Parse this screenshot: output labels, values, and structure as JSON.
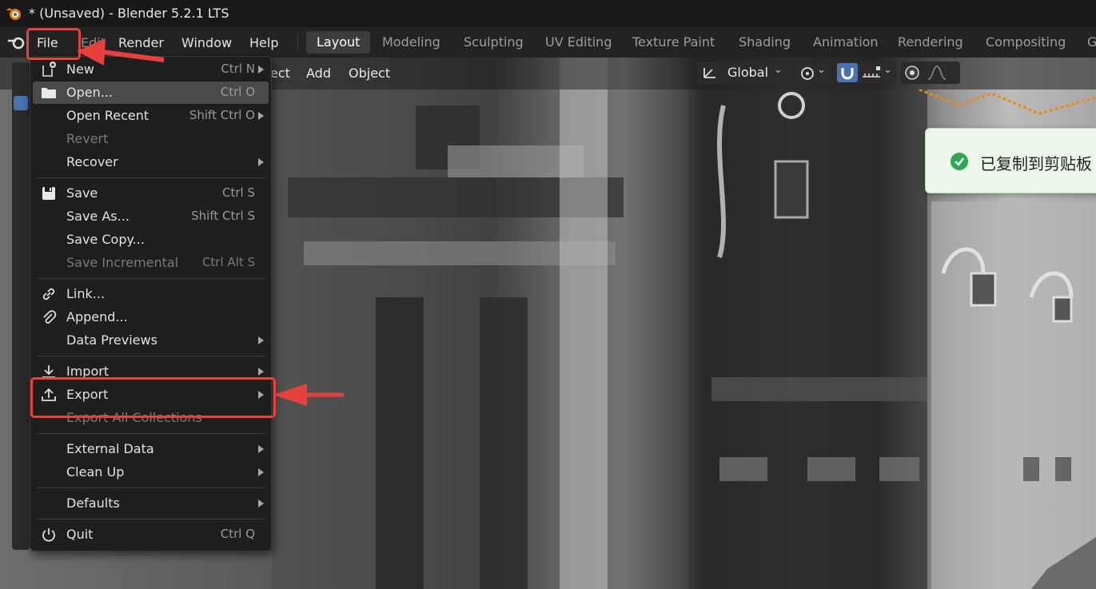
{
  "window": {
    "title": "* (Unsaved) - Blender 5.2.1 LTS"
  },
  "menubar": {
    "items": [
      "File",
      "Edit",
      "Render",
      "Window",
      "Help"
    ]
  },
  "workspaces": {
    "tabs": [
      "Layout",
      "Modeling",
      "Sculpting",
      "UV Editing",
      "Texture Paint",
      "Shading",
      "Animation",
      "Rendering",
      "Compositing",
      "G"
    ],
    "active": "Layout"
  },
  "viewport_header": {
    "select_partial": "ect",
    "add": "Add",
    "object": "Object",
    "transform_orientation": "Global",
    "left_edge_char": "#"
  },
  "file_menu": {
    "items": [
      {
        "label": "New",
        "shortcut": "Ctrl N",
        "submenu": true,
        "icon": "new-file-icon"
      },
      {
        "label": "Open...",
        "shortcut": "Ctrl O",
        "highlight": true,
        "icon": "folder-icon"
      },
      {
        "label": "Open Recent",
        "shortcut": "Shift Ctrl O",
        "submenu": true
      },
      {
        "label": "Revert",
        "disabled": true
      },
      {
        "label": "Recover",
        "submenu": true
      },
      {
        "label": "Save",
        "shortcut": "Ctrl S",
        "icon": "save-icon"
      },
      {
        "label": "Save As...",
        "shortcut": "Shift Ctrl S"
      },
      {
        "label": "Save Copy..."
      },
      {
        "label": "Save Incremental",
        "shortcut": "Ctrl Alt S",
        "disabled": true
      },
      {
        "label": "Link...",
        "icon": "link-icon"
      },
      {
        "label": "Append...",
        "icon": "paperclip-icon"
      },
      {
        "label": "Data Previews",
        "submenu": true
      },
      {
        "label": "Import",
        "submenu": true,
        "icon": "import-icon"
      },
      {
        "label": "Export",
        "submenu": true,
        "icon": "export-icon"
      },
      {
        "label": "Export All Collections",
        "disabled": true
      },
      {
        "label": "External Data",
        "submenu": true
      },
      {
        "label": "Clean Up",
        "submenu": true
      },
      {
        "label": "Defaults",
        "submenu": true
      },
      {
        "label": "Quit",
        "shortcut": "Ctrl Q",
        "icon": "power-icon"
      }
    ]
  },
  "toast": {
    "message": "已复制到剪贴板"
  },
  "colors": {
    "annotation_red": "#e8403c",
    "highlight": "#4a4a4a",
    "toast_bg": "#eaf7e9",
    "toast_check": "#2fa84f"
  }
}
